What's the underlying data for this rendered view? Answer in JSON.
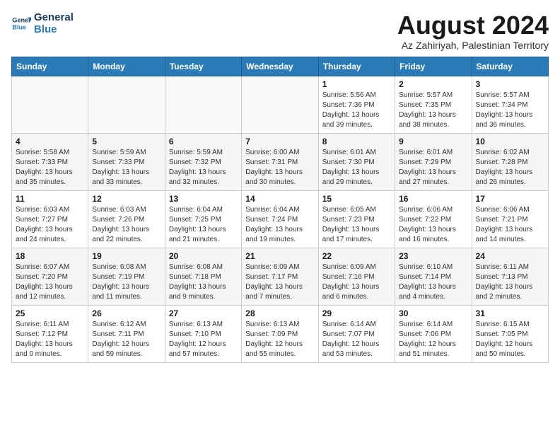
{
  "logo": {
    "line1": "General",
    "line2": "Blue"
  },
  "title": "August 2024",
  "location": "Az Zahiriyah, Palestinian Territory",
  "days_header": [
    "Sunday",
    "Monday",
    "Tuesday",
    "Wednesday",
    "Thursday",
    "Friday",
    "Saturday"
  ],
  "weeks": [
    [
      {
        "day": "",
        "info": ""
      },
      {
        "day": "",
        "info": ""
      },
      {
        "day": "",
        "info": ""
      },
      {
        "day": "",
        "info": ""
      },
      {
        "day": "1",
        "info": "Sunrise: 5:56 AM\nSunset: 7:36 PM\nDaylight: 13 hours\nand 39 minutes."
      },
      {
        "day": "2",
        "info": "Sunrise: 5:57 AM\nSunset: 7:35 PM\nDaylight: 13 hours\nand 38 minutes."
      },
      {
        "day": "3",
        "info": "Sunrise: 5:57 AM\nSunset: 7:34 PM\nDaylight: 13 hours\nand 36 minutes."
      }
    ],
    [
      {
        "day": "4",
        "info": "Sunrise: 5:58 AM\nSunset: 7:33 PM\nDaylight: 13 hours\nand 35 minutes."
      },
      {
        "day": "5",
        "info": "Sunrise: 5:59 AM\nSunset: 7:33 PM\nDaylight: 13 hours\nand 33 minutes."
      },
      {
        "day": "6",
        "info": "Sunrise: 5:59 AM\nSunset: 7:32 PM\nDaylight: 13 hours\nand 32 minutes."
      },
      {
        "day": "7",
        "info": "Sunrise: 6:00 AM\nSunset: 7:31 PM\nDaylight: 13 hours\nand 30 minutes."
      },
      {
        "day": "8",
        "info": "Sunrise: 6:01 AM\nSunset: 7:30 PM\nDaylight: 13 hours\nand 29 minutes."
      },
      {
        "day": "9",
        "info": "Sunrise: 6:01 AM\nSunset: 7:29 PM\nDaylight: 13 hours\nand 27 minutes."
      },
      {
        "day": "10",
        "info": "Sunrise: 6:02 AM\nSunset: 7:28 PM\nDaylight: 13 hours\nand 26 minutes."
      }
    ],
    [
      {
        "day": "11",
        "info": "Sunrise: 6:03 AM\nSunset: 7:27 PM\nDaylight: 13 hours\nand 24 minutes."
      },
      {
        "day": "12",
        "info": "Sunrise: 6:03 AM\nSunset: 7:26 PM\nDaylight: 13 hours\nand 22 minutes."
      },
      {
        "day": "13",
        "info": "Sunrise: 6:04 AM\nSunset: 7:25 PM\nDaylight: 13 hours\nand 21 minutes."
      },
      {
        "day": "14",
        "info": "Sunrise: 6:04 AM\nSunset: 7:24 PM\nDaylight: 13 hours\nand 19 minutes."
      },
      {
        "day": "15",
        "info": "Sunrise: 6:05 AM\nSunset: 7:23 PM\nDaylight: 13 hours\nand 17 minutes."
      },
      {
        "day": "16",
        "info": "Sunrise: 6:06 AM\nSunset: 7:22 PM\nDaylight: 13 hours\nand 16 minutes."
      },
      {
        "day": "17",
        "info": "Sunrise: 6:06 AM\nSunset: 7:21 PM\nDaylight: 13 hours\nand 14 minutes."
      }
    ],
    [
      {
        "day": "18",
        "info": "Sunrise: 6:07 AM\nSunset: 7:20 PM\nDaylight: 13 hours\nand 12 minutes."
      },
      {
        "day": "19",
        "info": "Sunrise: 6:08 AM\nSunset: 7:19 PM\nDaylight: 13 hours\nand 11 minutes."
      },
      {
        "day": "20",
        "info": "Sunrise: 6:08 AM\nSunset: 7:18 PM\nDaylight: 13 hours\nand 9 minutes."
      },
      {
        "day": "21",
        "info": "Sunrise: 6:09 AM\nSunset: 7:17 PM\nDaylight: 13 hours\nand 7 minutes."
      },
      {
        "day": "22",
        "info": "Sunrise: 6:09 AM\nSunset: 7:16 PM\nDaylight: 13 hours\nand 6 minutes."
      },
      {
        "day": "23",
        "info": "Sunrise: 6:10 AM\nSunset: 7:14 PM\nDaylight: 13 hours\nand 4 minutes."
      },
      {
        "day": "24",
        "info": "Sunrise: 6:11 AM\nSunset: 7:13 PM\nDaylight: 13 hours\nand 2 minutes."
      }
    ],
    [
      {
        "day": "25",
        "info": "Sunrise: 6:11 AM\nSunset: 7:12 PM\nDaylight: 13 hours\nand 0 minutes."
      },
      {
        "day": "26",
        "info": "Sunrise: 6:12 AM\nSunset: 7:11 PM\nDaylight: 12 hours\nand 59 minutes."
      },
      {
        "day": "27",
        "info": "Sunrise: 6:13 AM\nSunset: 7:10 PM\nDaylight: 12 hours\nand 57 minutes."
      },
      {
        "day": "28",
        "info": "Sunrise: 6:13 AM\nSunset: 7:09 PM\nDaylight: 12 hours\nand 55 minutes."
      },
      {
        "day": "29",
        "info": "Sunrise: 6:14 AM\nSunset: 7:07 PM\nDaylight: 12 hours\nand 53 minutes."
      },
      {
        "day": "30",
        "info": "Sunrise: 6:14 AM\nSunset: 7:06 PM\nDaylight: 12 hours\nand 51 minutes."
      },
      {
        "day": "31",
        "info": "Sunrise: 6:15 AM\nSunset: 7:05 PM\nDaylight: 12 hours\nand 50 minutes."
      }
    ]
  ]
}
